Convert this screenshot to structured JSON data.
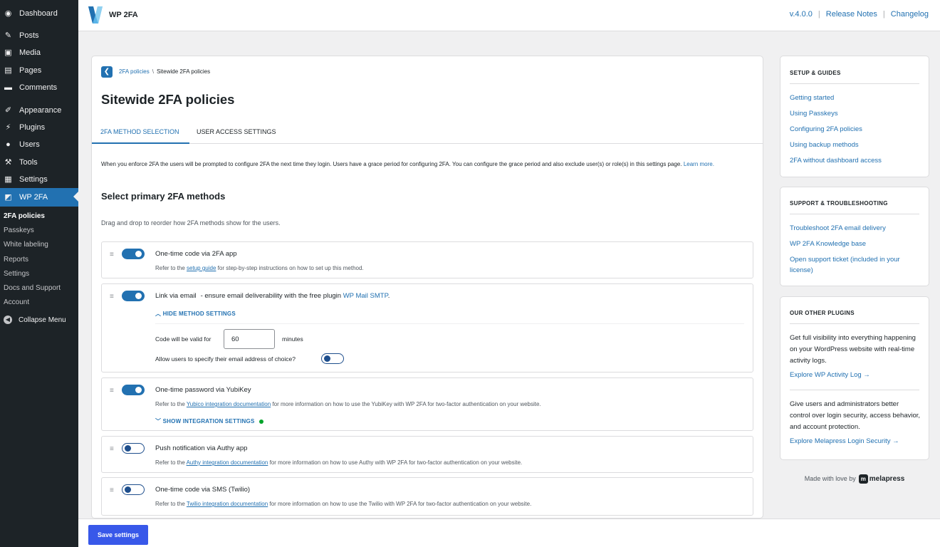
{
  "admin_menu": {
    "items": [
      {
        "label": "Dashboard",
        "icon": "dashboard-icon"
      },
      {
        "label": "Posts",
        "icon": "pin-icon"
      },
      {
        "label": "Media",
        "icon": "media-icon"
      },
      {
        "label": "Pages",
        "icon": "pages-icon"
      },
      {
        "label": "Comments",
        "icon": "comment-icon"
      },
      {
        "label": "Appearance",
        "icon": "brush-icon"
      },
      {
        "label": "Plugins",
        "icon": "plug-icon"
      },
      {
        "label": "Users",
        "icon": "user-icon"
      },
      {
        "label": "Tools",
        "icon": "wrench-icon"
      },
      {
        "label": "Settings",
        "icon": "sliders-icon"
      },
      {
        "label": "WP 2FA",
        "icon": "wp2fa-icon"
      }
    ],
    "submenu": [
      "2FA policies",
      "Passkeys",
      "White labeling",
      "Reports",
      "Settings",
      "Docs and Support",
      "Account"
    ],
    "collapse_label": "Collapse Menu"
  },
  "header": {
    "brand": "WP 2FA",
    "version": "v.4.0.0",
    "release_notes": "Release Notes",
    "changelog": "Changelog",
    "separator": "|"
  },
  "breadcrumb": {
    "parent": "2FA policies",
    "separator": "\\",
    "current": "Sitewide 2FA policies"
  },
  "page": {
    "title": "Sitewide 2FA policies",
    "tabs": [
      "2FA METHOD SELECTION",
      "USER ACCESS SETTINGS"
    ],
    "active_tab": "2FA METHOD SELECTION",
    "intro_text": "When you enforce 2FA the users will be prompted to configure 2FA the next time they login. Users have a grace period for configuring 2FA. You can configure the grace period and also exclude user(s) or role(s) in this settings page.",
    "learn_more": "Learn more.",
    "section_title": "Select primary 2FA methods",
    "drag_hint": "Drag and drop to reorder how 2FA methods show for the users."
  },
  "methods": [
    {
      "title": "One-time code via 2FA app",
      "enabled": true,
      "desc_pre": "Refer to the",
      "desc_link": "setup guide",
      "desc_post": "for step-by-step instructions on how to set up this method."
    },
    {
      "title": "Link via email",
      "enabled": true,
      "extra_text": "- ensure email deliverability with the free plugin",
      "extra_link": "WP Mail SMTP",
      "extra_end": ".",
      "settings_toggle": "HIDE METHOD SETTINGS",
      "code_valid_label": "Code will be valid for",
      "code_valid_value": "60",
      "code_valid_unit": "minutes",
      "allow_email_label": "Allow users to specify their email address of choice?",
      "allow_email_enabled": false
    },
    {
      "title": "One-time password via YubiKey",
      "enabled": true,
      "desc_pre": "Refer to the",
      "desc_link": "Yubico integration documentation",
      "desc_post": "for more information on how to use the YubiKey with WP 2FA for two-factor authentication on your website.",
      "settings_toggle": "SHOW INTEGRATION SETTINGS"
    },
    {
      "title": "Push notification via Authy app",
      "enabled": false,
      "desc_pre": "Refer to the",
      "desc_link": "Authy integration documentation",
      "desc_post": "for more information on how to use Authy with WP 2FA for two-factor authentication on your website."
    },
    {
      "title": "One-time code via SMS (Twilio)",
      "enabled": false,
      "desc_pre": "Refer to the",
      "desc_link": "Twilio integration documentation",
      "desc_post": "for more information on how to use the Twilio with WP 2FA for two-factor authentication on your website."
    }
  ],
  "footer": {
    "save_label": "Save settings"
  },
  "sidebar": {
    "setup": {
      "title": "SETUP & GUIDES",
      "links": [
        "Getting started",
        "Using Passkeys",
        "Configuring 2FA policies",
        "Using backup methods",
        "2FA without dashboard access"
      ]
    },
    "support": {
      "title": "SUPPORT & TROUBLESHOOTING",
      "links": [
        "Troubleshoot 2FA email delivery",
        "WP 2FA Knowledge base",
        "Open support ticket (included in your license)"
      ]
    },
    "plugins": {
      "title": "OUR OTHER PLUGINS",
      "p1_text": "Get full visibility into everything happening on your WordPress website with real-time activity logs.",
      "p1_link": "Explore WP Activity Log →",
      "p2_text": "Give users and administrators better control over login security, access behavior, and account protection.",
      "p2_link": "Explore Melapress Login Security →"
    },
    "made_with": "Made with love by",
    "made_with_brand": "melapress"
  },
  "colors": {
    "admin_bg": "#1d2327",
    "accent": "#2271b1",
    "save_button": "#3858e9",
    "status_dot": "#00a32a"
  }
}
